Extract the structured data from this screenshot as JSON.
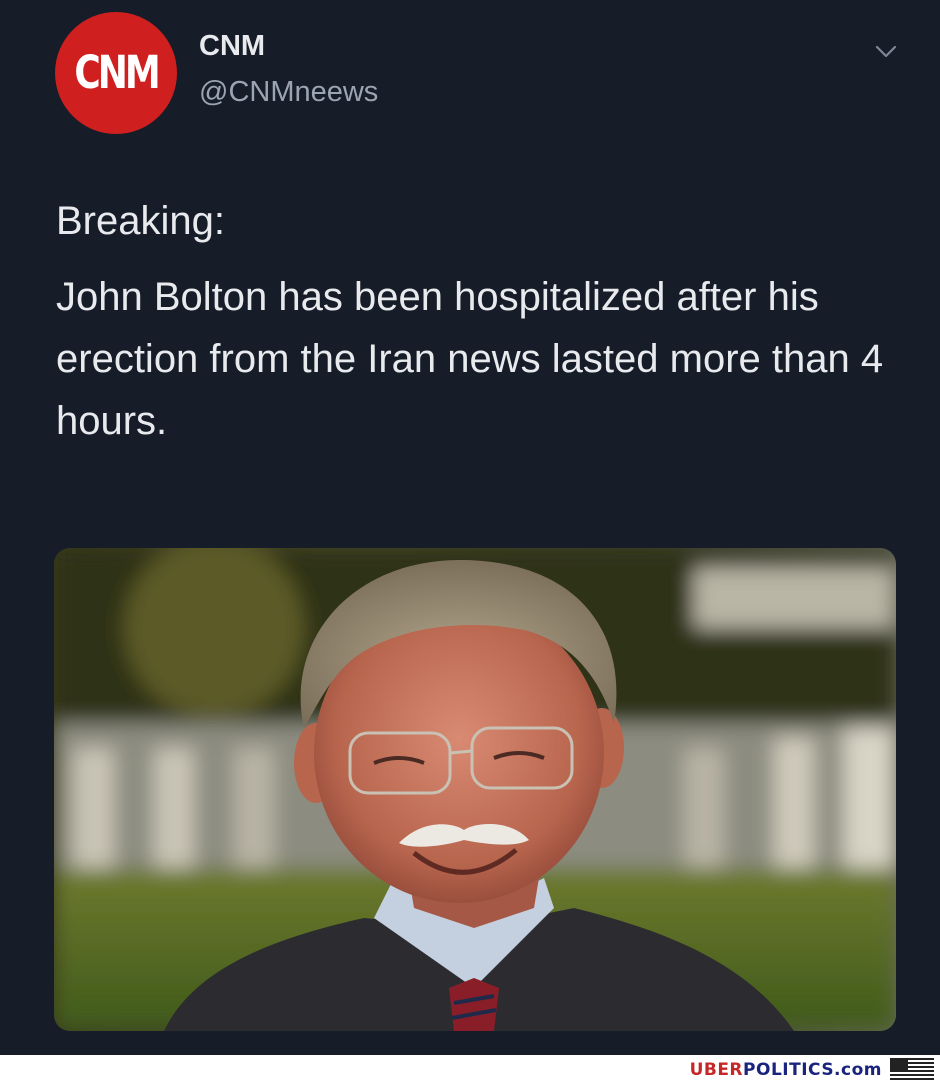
{
  "tweet": {
    "avatar_text": "CNM",
    "display_name": "CNM",
    "handle": "@CNMneews",
    "breaking": "Breaking:",
    "body": "John Bolton has been hospitalized after his erection from the Iran news lasted more than 4 hours."
  },
  "footer": {
    "brand_part1": "UBER",
    "brand_part2": "POLITICS.com"
  },
  "colors": {
    "background": "#161d29",
    "avatar": "#cf1f1f",
    "text": "#e8eaed",
    "handle": "#9aa4b2"
  }
}
